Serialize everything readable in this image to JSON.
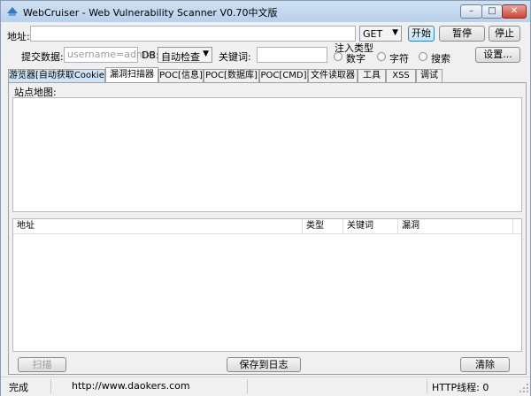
{
  "window": {
    "title": "WebCruiser - Web Vulnerability Scanner V0.70中文版",
    "minimize": "–",
    "maximize": "□",
    "close": "✕"
  },
  "toolbar": {
    "address_label": "地址:",
    "address_value": "",
    "method": "GET",
    "start": "开始",
    "pause": "暂停",
    "stop": "停止",
    "post_label": "提交数据:",
    "post_placeholder": "username=admin",
    "db_label": "DB:",
    "db_value": "自动检查",
    "keyword_label": "关键词:",
    "keyword_value": "",
    "inject_type_label": "注入类型",
    "radio_number": "数字",
    "radio_string": "字符",
    "radio_search": "搜索",
    "settings": "设置..."
  },
  "tabs": [
    "游览器[自动获取Cookie]",
    "漏洞扫描器",
    "POC[信息]",
    "POC[数据库]",
    "POC[CMD]",
    "文件读取器",
    "工具",
    "XSS",
    "调试"
  ],
  "scanner": {
    "sitemap_label": "站点地图:",
    "columns": [
      "地址",
      "类型",
      "关键词",
      "漏洞"
    ],
    "scan_button": "扫描",
    "save_log_button": "保存到日志",
    "clear_button": "清除"
  },
  "status": {
    "state": "完成",
    "url": "http://www.daokers.com",
    "http_threads": "HTTP线程: 0"
  },
  "colors": {
    "titlebar": "#b9d0ea",
    "active_button": "#c4e3f7",
    "first_tab": "#cfe5f7"
  }
}
